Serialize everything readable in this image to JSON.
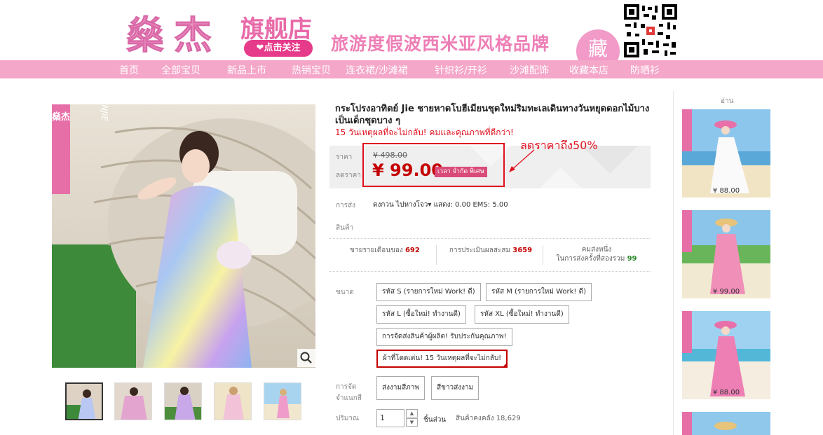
{
  "banner": {
    "brand": "燊杰",
    "store_name": "旗舰店",
    "follow_label": "❤点击关注",
    "slogan": "旅游度假波西米亚风格品牌",
    "favorite_label": "藏"
  },
  "nav": {
    "items": [
      "首页",
      "全部宝贝",
      "新品上市",
      "热销宝贝",
      "连衣裙/沙滩裙",
      "针织衫/开衫",
      "沙滩配饰",
      "收藏本店",
      "防晒衫"
    ]
  },
  "product": {
    "title": "กระโปรงอาทิตย์ Jie ชายหาดโบฮีเมียนชุดใหม่ริมทะเลเดินทางวันหยุดดอกไม้บางเป็นเด็กชุดบาง ๆ",
    "subtitle": "15 วันเหตุผลที่จะไม่กลับ! คมและคุณภาพที่ดีกว่า!",
    "price_label": "ราคา",
    "discount_label": "ลดราคา",
    "original_price": "¥ 498.00",
    "current_price": "¥ 99.00",
    "promo_tag": "เวลา จำกัด พิเศษ",
    "annotation": "ลดราคาถึง50%",
    "shipping_label": "การส่ง",
    "shipping_text": "ดงกวน  ไปหางโจว▾ แสดง: 0.00 EMS: 5.00",
    "product_label": "สินค้า",
    "stats": {
      "monthly_sales_label": "ขายรายเดือนของ",
      "monthly_sales_value": "692",
      "reviews_label": "การประเมินผลสะสม",
      "reviews_value": "3659",
      "points_label_1": "คมส่งหนึ่ง",
      "points_label_2": "ในการส่งครั้งที่สองรวม",
      "points_value": "99"
    },
    "size_label": "ขนาด",
    "sizes": [
      "รหัส S (รายการใหม่ Work! ดี)",
      "รหัส M (รายการใหม่ Work! ดี)",
      "รหัส L (ซื้อใหม่! ทำงานดี)",
      "รหัส XL (ซื้อใหม่! ทำงานดี)",
      "การจัดส่งสินค้าผู้ผลิต! รับประกันคุณภาพ!",
      "ผ้าที่โดดเด่น! 15 วันเหตุผลที่จะไม่กลับ!"
    ],
    "color_label_1": "การจัด",
    "color_label_2": "จำแนกสี",
    "colors": [
      "ส่งงามสีภาพ",
      "สีขาวส่งงาม"
    ],
    "qty_label": "ปริมาณ",
    "qty_value": "1",
    "qty_unit": "ชิ้นส่วน",
    "stock_text": "สินค้าคงคลัง 18,629",
    "stepper_up": "▲",
    "stepper_down": "▼"
  },
  "sidebar": {
    "title": "อ่าน",
    "prices": [
      "¥ 88.00",
      "¥ 99.00",
      "¥ 88.00"
    ]
  },
  "image_text": {
    "brand_vertical": "燊杰",
    "brand_latin": "SHENJIE"
  }
}
